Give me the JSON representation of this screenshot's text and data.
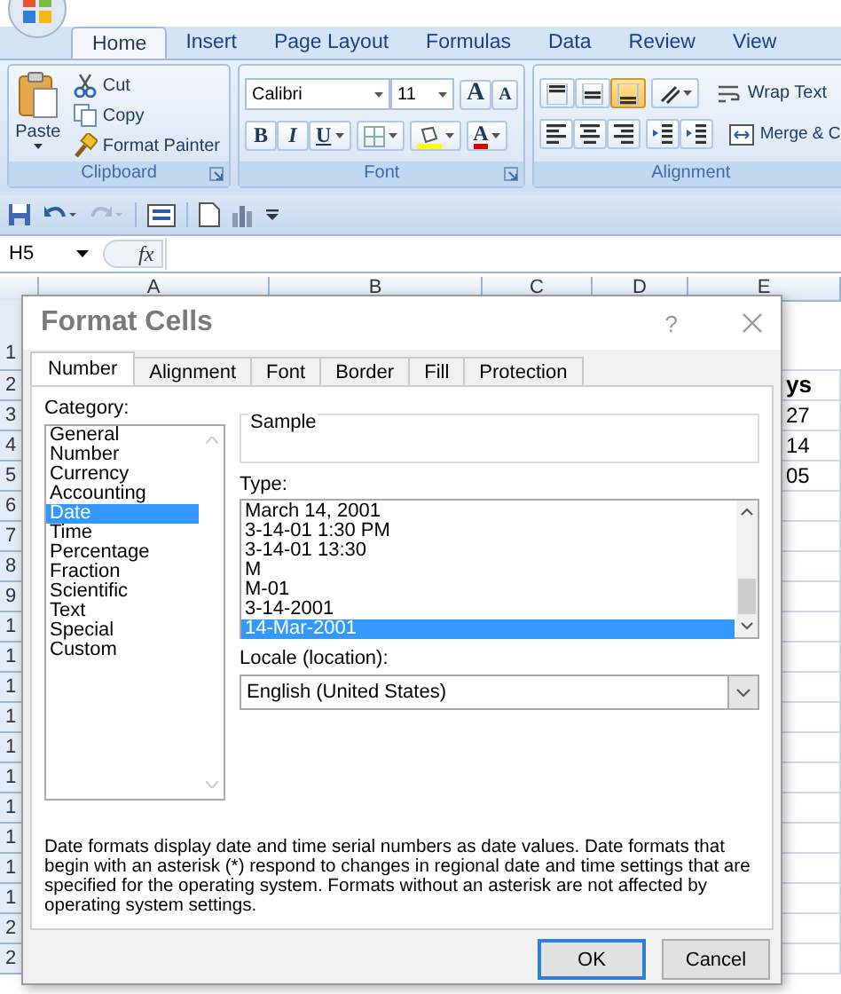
{
  "ribbon": {
    "tabs": [
      {
        "label": "Home",
        "selected": true
      },
      {
        "label": "Insert",
        "selected": false
      },
      {
        "label": "Page Layout",
        "selected": false
      },
      {
        "label": "Formulas",
        "selected": false
      },
      {
        "label": "Data",
        "selected": false
      },
      {
        "label": "Review",
        "selected": false
      },
      {
        "label": "View",
        "selected": false
      }
    ],
    "clipboard": {
      "paste": "Paste",
      "cut": "Cut",
      "copy": "Copy",
      "format_painter": "Format Painter",
      "label": "Clipboard"
    },
    "font": {
      "name": "Calibri",
      "size": "11",
      "grow": "A",
      "shrink": "A",
      "bold": "B",
      "italic": "I",
      "underline": "U",
      "font_color_label": "A",
      "label": "Font"
    },
    "alignment": {
      "valign": [
        {
          "selected": false
        },
        {
          "selected": false
        },
        {
          "selected": true
        }
      ],
      "wrap": "Wrap Text",
      "merge": "Merge & C",
      "label": "Alignment"
    }
  },
  "formula_bar": {
    "name_box": "H5",
    "fx": "fx"
  },
  "sheet": {
    "columns": [
      "A",
      "B",
      "C",
      "D",
      "E"
    ],
    "rows": [
      "1",
      "2",
      "3",
      "4",
      "5",
      "6",
      "7",
      "8",
      "9",
      "1",
      "1",
      "1",
      "1",
      "1",
      "1",
      "1",
      "1",
      "1",
      "1",
      "2",
      "2"
    ],
    "column_e_cells": [
      {
        "text": "ys",
        "bold": true
      },
      {
        "text": "27",
        "bold": false
      },
      {
        "text": "14",
        "bold": false
      },
      {
        "text": "05",
        "bold": false
      }
    ]
  },
  "dialog": {
    "title": "Format Cells",
    "help": "?",
    "tabs": [
      {
        "label": "Number",
        "selected": true
      },
      {
        "label": "Alignment",
        "selected": false
      },
      {
        "label": "Font",
        "selected": false
      },
      {
        "label": "Border",
        "selected": false
      },
      {
        "label": "Fill",
        "selected": false
      },
      {
        "label": "Protection",
        "selected": false
      }
    ],
    "category_label": "Category:",
    "categories": [
      {
        "label": "General",
        "selected": false
      },
      {
        "label": "Number",
        "selected": false
      },
      {
        "label": "Currency",
        "selected": false
      },
      {
        "label": "Accounting",
        "selected": false
      },
      {
        "label": "Date",
        "selected": true
      },
      {
        "label": "Time",
        "selected": false
      },
      {
        "label": "Percentage",
        "selected": false
      },
      {
        "label": "Fraction",
        "selected": false
      },
      {
        "label": "Scientific",
        "selected": false
      },
      {
        "label": "Text",
        "selected": false
      },
      {
        "label": "Special",
        "selected": false
      },
      {
        "label": "Custom",
        "selected": false
      }
    ],
    "sample_label": "Sample",
    "type_label": "Type:",
    "types": [
      {
        "label": "March 14, 2001",
        "selected": false
      },
      {
        "label": "3-14-01 1:30 PM",
        "selected": false
      },
      {
        "label": "3-14-01 13:30",
        "selected": false
      },
      {
        "label": "M",
        "selected": false
      },
      {
        "label": "M-01",
        "selected": false
      },
      {
        "label": "3-14-2001",
        "selected": false
      },
      {
        "label": "14-Mar-2001",
        "selected": true
      }
    ],
    "locale_label": "Locale (location):",
    "locale": "English (United States)",
    "description": "Date formats display date and time serial numbers as date values.  Date formats that begin with an asterisk (*) respond to changes in regional date and time settings that are specified for the operating system. Formats without an asterisk are not affected by operating system settings.",
    "buttons": [
      {
        "label": "OK",
        "kind": "default"
      },
      {
        "label": "Cancel",
        "kind": "normal"
      }
    ]
  }
}
